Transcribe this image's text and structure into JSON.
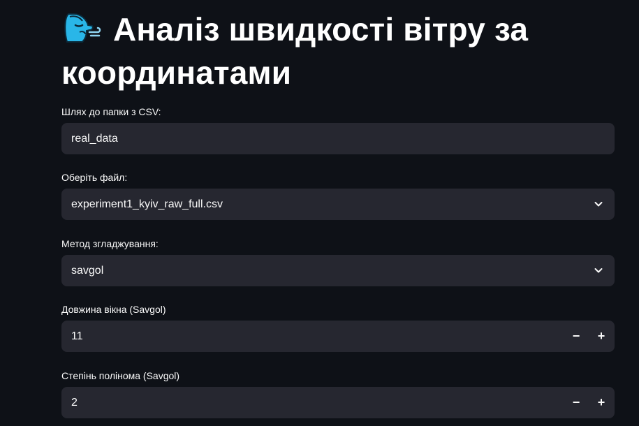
{
  "header": {
    "title": "Аналіз швидкості вітру за координатами",
    "icon": "wind-face-icon"
  },
  "form": {
    "folder_path": {
      "label": "Шлях до папки з CSV:",
      "value": "real_data"
    },
    "file_select": {
      "label": "Оберіть файл:",
      "value": "experiment1_kyiv_raw_full.csv"
    },
    "smoothing_method": {
      "label": "Метод згладжування:",
      "value": "savgol"
    },
    "window_length": {
      "label": "Довжина вікна (Savgol)",
      "value": "11",
      "minus": "−",
      "plus": "+"
    },
    "poly_order": {
      "label": "Степінь полінома (Savgol)",
      "value": "2",
      "minus": "−",
      "plus": "+"
    }
  },
  "colors": {
    "background": "#0e1117",
    "input_bg": "#262730",
    "text": "#fafafa",
    "icon_cyan": "#29b6e8"
  }
}
